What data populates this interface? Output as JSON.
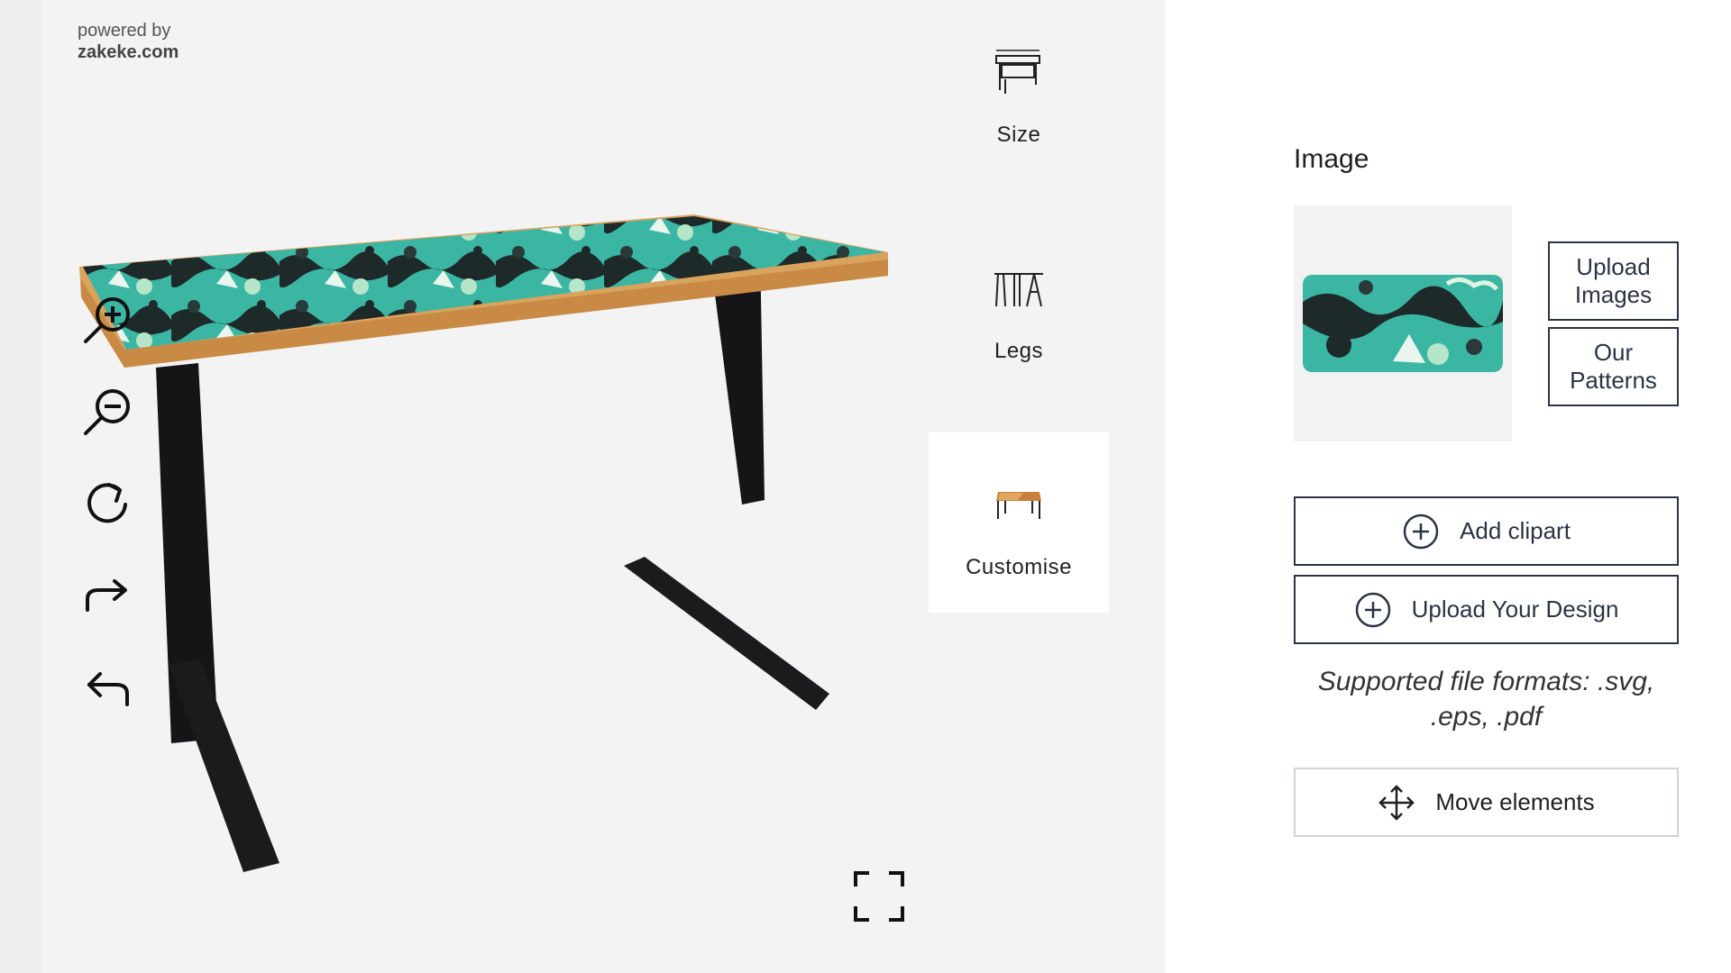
{
  "branding": {
    "powered_by": "powered by",
    "brand": "zakeke.com"
  },
  "viewer_tools": [
    {
      "name": "zoom-in",
      "icon": "zoom-in-icon"
    },
    {
      "name": "zoom-out",
      "icon": "zoom-out-icon"
    },
    {
      "name": "reset-view",
      "icon": "rotate-icon"
    },
    {
      "name": "redo",
      "icon": "redo-arrow-icon"
    },
    {
      "name": "undo",
      "icon": "undo-arrow-icon"
    }
  ],
  "fullscreen_icon": "fullscreen-icon",
  "options": [
    {
      "label": "Size",
      "icon": "desk-size-icon",
      "active": false
    },
    {
      "label": "Legs",
      "icon": "desk-legs-icon",
      "active": false
    },
    {
      "label": "Customise",
      "icon": "desk-customise-icon",
      "active": true
    }
  ],
  "panel": {
    "title": "Image",
    "upload_images": "Upload Images",
    "our_patterns": "Our Patterns",
    "add_clipart": "Add clipart",
    "upload_design": "Upload Your Design",
    "formats_note": "Supported file formats: .svg, .eps, .pdf",
    "move_elements": "Move elements"
  },
  "colors": {
    "accent_teal": "#3fb8a4",
    "button_border": "#2b3344",
    "leg_color": "#1b1b1d",
    "wood_edge": "#d9a25d"
  }
}
